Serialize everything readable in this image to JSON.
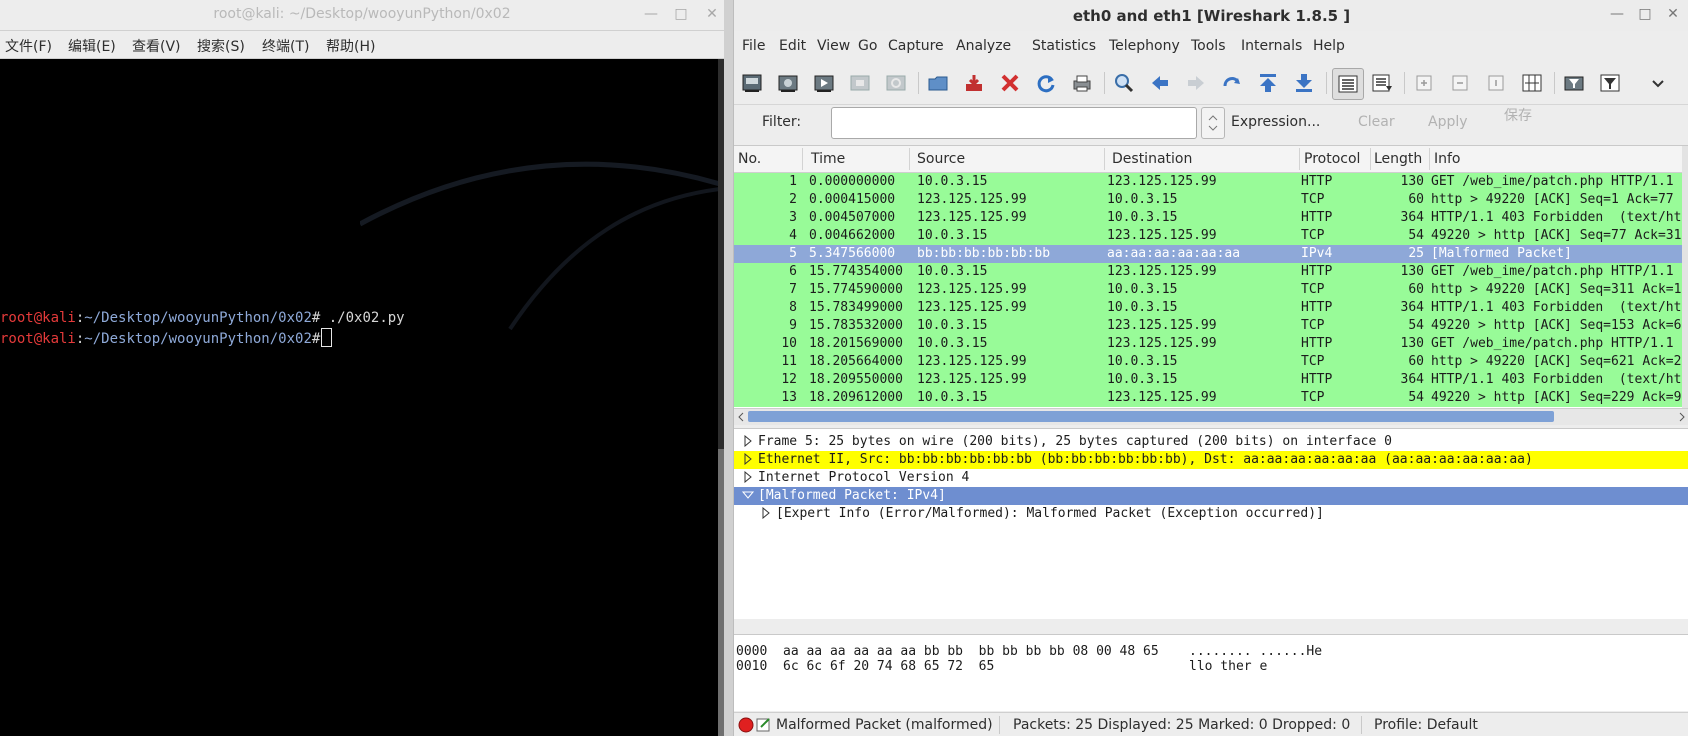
{
  "terminal": {
    "title": "root@kali: ~/Desktop/wooyunPython/0x02",
    "menu": [
      "文件(F)",
      "编辑(E)",
      "查看(V)",
      "搜索(S)",
      "终端(T)",
      "帮助(H)"
    ],
    "lines": [
      {
        "user": "root@kali",
        "sep": ":",
        "path": "~/Desktop/wooyunPython/0x02",
        "prompt": "#",
        "cmd": " ./0x02.py"
      },
      {
        "user": "root@kali",
        "sep": ":",
        "path": "~/Desktop/wooyunPython/0x02",
        "prompt": "#",
        "cmd": ""
      }
    ]
  },
  "wireshark": {
    "title": "eth0 and eth1   [Wireshark 1.8.5 ]",
    "menu": [
      "File",
      "Edit",
      "View",
      "Go",
      "Capture",
      "Analyze",
      "Statistics",
      "Telephony",
      "Tools",
      "Internals",
      "Help"
    ],
    "filter": {
      "label": "Filter:",
      "value": "",
      "expression": "Expression...",
      "clear": "Clear",
      "apply": "Apply",
      "save": "保存"
    },
    "columns": [
      "No.",
      "Time",
      "Source",
      "Destination",
      "Protocol",
      "Length",
      "Info"
    ],
    "packets": [
      {
        "no": "1",
        "time": "0.000000000",
        "src": "10.0.3.15",
        "dst": "123.125.125.99",
        "proto": "HTTP",
        "len": "130",
        "info": "GET /web_ime/patch.php HTTP/1.1"
      },
      {
        "no": "2",
        "time": "0.000415000",
        "src": "123.125.125.99",
        "dst": "10.0.3.15",
        "proto": "TCP",
        "len": "60",
        "info": "http > 49220 [ACK] Seq=1 Ack=77"
      },
      {
        "no": "3",
        "time": "0.004507000",
        "src": "123.125.125.99",
        "dst": "10.0.3.15",
        "proto": "HTTP",
        "len": "364",
        "info": "HTTP/1.1 403 Forbidden  (text/ht"
      },
      {
        "no": "4",
        "time": "0.004662000",
        "src": "10.0.3.15",
        "dst": "123.125.125.99",
        "proto": "TCP",
        "len": "54",
        "info": "49220 > http [ACK] Seq=77 Ack=31"
      },
      {
        "no": "5",
        "time": "5.347566000",
        "src": "bb:bb:bb:bb:bb:bb",
        "dst": "aa:aa:aa:aa:aa:aa",
        "proto": "IPv4",
        "len": "25",
        "info": "[Malformed Packet]"
      },
      {
        "no": "6",
        "time": "15.774354000",
        "src": "10.0.3.15",
        "dst": "123.125.125.99",
        "proto": "HTTP",
        "len": "130",
        "info": "GET /web_ime/patch.php HTTP/1.1"
      },
      {
        "no": "7",
        "time": "15.774590000",
        "src": "123.125.125.99",
        "dst": "10.0.3.15",
        "proto": "TCP",
        "len": "60",
        "info": "http > 49220 [ACK] Seq=311 Ack=1"
      },
      {
        "no": "8",
        "time": "15.783499000",
        "src": "123.125.125.99",
        "dst": "10.0.3.15",
        "proto": "HTTP",
        "len": "364",
        "info": "HTTP/1.1 403 Forbidden  (text/ht"
      },
      {
        "no": "9",
        "time": "15.783532000",
        "src": "10.0.3.15",
        "dst": "123.125.125.99",
        "proto": "TCP",
        "len": "54",
        "info": "49220 > http [ACK] Seq=153 Ack=6"
      },
      {
        "no": "10",
        "time": "18.201569000",
        "src": "10.0.3.15",
        "dst": "123.125.125.99",
        "proto": "HTTP",
        "len": "130",
        "info": "GET /web_ime/patch.php HTTP/1.1"
      },
      {
        "no": "11",
        "time": "18.205664000",
        "src": "123.125.125.99",
        "dst": "10.0.3.15",
        "proto": "TCP",
        "len": "60",
        "info": "http > 49220 [ACK] Seq=621 Ack=2"
      },
      {
        "no": "12",
        "time": "18.209550000",
        "src": "123.125.125.99",
        "dst": "10.0.3.15",
        "proto": "HTTP",
        "len": "364",
        "info": "HTTP/1.1 403 Forbidden  (text/ht"
      },
      {
        "no": "13",
        "time": "18.209612000",
        "src": "10.0.3.15",
        "dst": "123.125.125.99",
        "proto": "TCP",
        "len": "54",
        "info": "49220 > http [ACK] Seq=229 Ack=9"
      }
    ],
    "selected_packet": "5",
    "details": [
      {
        "text": "Frame 5: 25 bytes on wire (200 bits), 25 bytes captured (200 bits) on interface 0",
        "expanded": false,
        "level": 0,
        "style": "normal"
      },
      {
        "text": "Ethernet II, Src: bb:bb:bb:bb:bb:bb (bb:bb:bb:bb:bb:bb), Dst: aa:aa:aa:aa:aa:aa (aa:aa:aa:aa:aa:aa)",
        "expanded": false,
        "level": 0,
        "style": "warn"
      },
      {
        "text": "Internet Protocol Version 4",
        "expanded": false,
        "level": 0,
        "style": "normal"
      },
      {
        "text": "[Malformed Packet: IPv4]",
        "expanded": true,
        "level": 0,
        "style": "selected"
      },
      {
        "text": "[Expert Info (Error/Malformed): Malformed Packet (Exception occurred)]",
        "expanded": false,
        "level": 1,
        "style": "normal"
      }
    ],
    "bytes": [
      {
        "offset": "0000",
        "hex": "aa aa aa aa aa aa bb bb  bb bb bb bb 08 00 48 65",
        "ascii": "........ ......He"
      },
      {
        "offset": "0010",
        "hex": "6c 6c 6f 20 74 68 65 72  65",
        "ascii": "llo ther e"
      }
    ],
    "status": {
      "expert": "Malformed Packet (malformed)",
      "packets": "Packets: 25 Displayed: 25 Marked: 0 Dropped: 0",
      "profile": "Profile: Default"
    },
    "colors": {
      "row_green": "#98fb98",
      "row_selected": "#8ea8d8",
      "detail_warning": "#ffff00",
      "detail_selected": "#6e8ed0",
      "expert_error": "#e02020"
    }
  }
}
